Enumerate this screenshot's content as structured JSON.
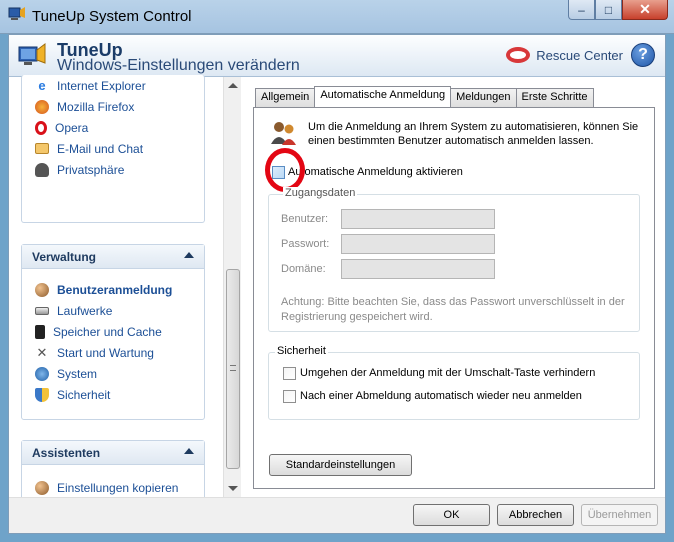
{
  "window": {
    "title": "TuneUp System Control",
    "min_symbol": "–",
    "max_symbol": "□",
    "close_symbol": "✕"
  },
  "header": {
    "brand": "TuneUp",
    "subtitle": "Windows-Einstellungen verändern",
    "rescue_label": "Rescue Center",
    "help_symbol": "?"
  },
  "sidebar": {
    "top_items": [
      {
        "label": "Internet Explorer",
        "icon": "internet-explorer-icon"
      },
      {
        "label": "Mozilla Firefox",
        "icon": "firefox-icon"
      },
      {
        "label": "Opera",
        "icon": "opera-icon"
      },
      {
        "label": "E-Mail und Chat",
        "icon": "mail-icon"
      },
      {
        "label": "Privatsphäre",
        "icon": "privacy-icon"
      }
    ],
    "verwaltung": {
      "title": "Verwaltung",
      "items": [
        {
          "label": "Benutzeranmeldung",
          "icon": "users-icon"
        },
        {
          "label": "Laufwerke",
          "icon": "drive-icon"
        },
        {
          "label": "Speicher und Cache",
          "icon": "memory-icon"
        },
        {
          "label": "Start und Wartung",
          "icon": "tools-icon"
        },
        {
          "label": "System",
          "icon": "system-icon"
        },
        {
          "label": "Sicherheit",
          "icon": "shield-icon"
        }
      ]
    },
    "assistenten": {
      "title": "Assistenten",
      "items": [
        {
          "label": "Einstellungen kopieren",
          "icon": "copy-settings-icon"
        }
      ]
    }
  },
  "tabs": [
    "Allgemein",
    "Automatische Anmeldung",
    "Meldungen",
    "Erste Schritte"
  ],
  "content": {
    "intro": "Um die Anmeldung an Ihrem System zu automatisieren, können Sie einen bestimmten Benutzer automatisch anmelden lassen.",
    "auto_login_label": "Automatische Anmeldung aktivieren",
    "credentials": {
      "title": "Zugangsdaten",
      "user_label": "Benutzer:",
      "password_label": "Passwort:",
      "domain_label": "Domäne:",
      "note": "Achtung: Bitte beachten Sie, dass das Passwort unverschlüsselt in der Registrierung gespeichert wird."
    },
    "security": {
      "title": "Sicherheit",
      "option1": "Umgehen der Anmeldung mit der Umschalt-Taste verhindern",
      "option2": "Nach einer Abmeldung automatisch wieder neu anmelden"
    },
    "defaults_button": "Standardeinstellungen"
  },
  "footer": {
    "ok": "OK",
    "cancel": "Abbrechen",
    "apply": "Übernehmen"
  }
}
